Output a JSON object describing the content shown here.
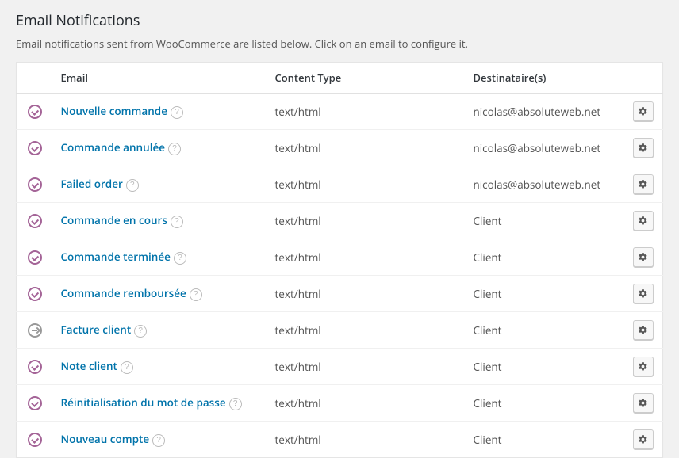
{
  "header": {
    "title": "Email Notifications",
    "description": "Email notifications sent from WooCommerce are listed below. Click on an email to configure it."
  },
  "table": {
    "columns": {
      "email": "Email",
      "content_type": "Content Type",
      "recipients": "Destinataire(s)"
    },
    "rows": [
      {
        "status": "enabled",
        "name": "Nouvelle commande",
        "content_type": "text/html",
        "recipient": "nicolas@absoluteweb.net"
      },
      {
        "status": "enabled",
        "name": "Commande annulée",
        "content_type": "text/html",
        "recipient": "nicolas@absoluteweb.net"
      },
      {
        "status": "enabled",
        "name": "Failed order",
        "content_type": "text/html",
        "recipient": "nicolas@absoluteweb.net"
      },
      {
        "status": "enabled",
        "name": "Commande en cours",
        "content_type": "text/html",
        "recipient": "Client"
      },
      {
        "status": "enabled",
        "name": "Commande terminée",
        "content_type": "text/html",
        "recipient": "Client"
      },
      {
        "status": "enabled",
        "name": "Commande remboursée",
        "content_type": "text/html",
        "recipient": "Client"
      },
      {
        "status": "manual",
        "name": "Facture client",
        "content_type": "text/html",
        "recipient": "Client"
      },
      {
        "status": "enabled",
        "name": "Note client",
        "content_type": "text/html",
        "recipient": "Client"
      },
      {
        "status": "enabled",
        "name": "Réinitialisation du mot de passe",
        "content_type": "text/html",
        "recipient": "Client"
      },
      {
        "status": "enabled",
        "name": "Nouveau compte",
        "content_type": "text/html",
        "recipient": "Client"
      }
    ]
  }
}
